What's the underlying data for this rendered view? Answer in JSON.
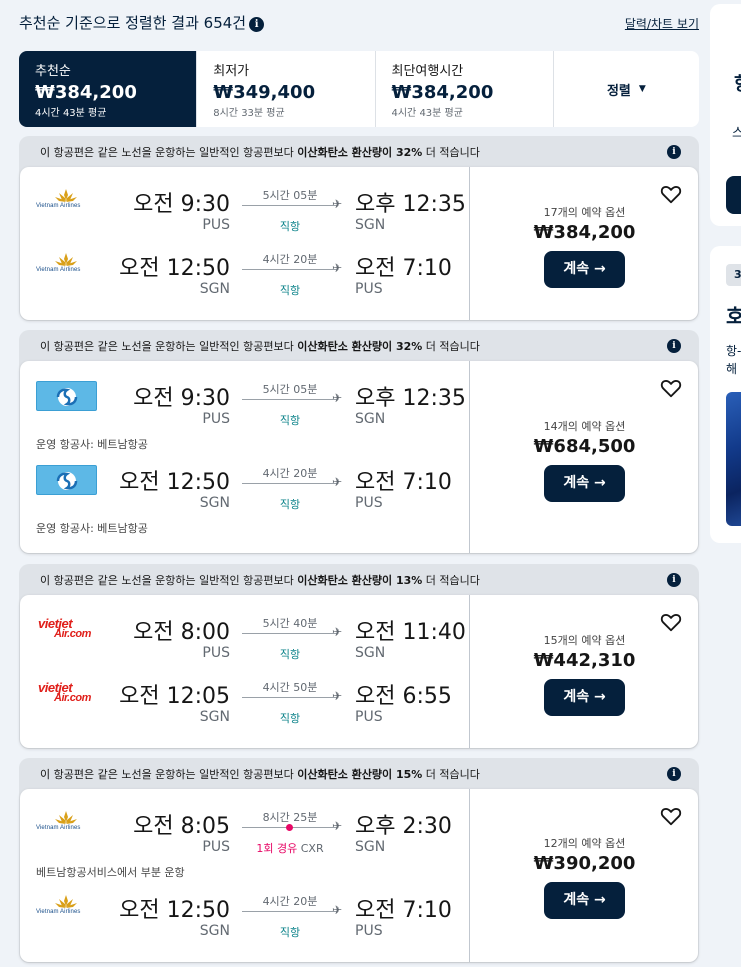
{
  "header": {
    "title": "추천순 기준으로 정렬한 결과 654건",
    "calendar_link": "달력/차트 보기"
  },
  "sort_tabs": [
    {
      "label": "추천순",
      "price": "₩384,200",
      "sub": "4시간 43분 평균"
    },
    {
      "label": "최저가",
      "price": "₩349,400",
      "sub": "8시간 33분 평균"
    },
    {
      "label": "최단여행시간",
      "price": "₩384,200",
      "sub": "4시간 43분 평균"
    }
  ],
  "sort_dropdown": "정렬",
  "cards": [
    {
      "eco_pre": "이 항공편은 같은 노선을 운항하는 일반적인 항공편보다 ",
      "eco_bold": "이산화탄소 환산량이 32%",
      "eco_post": " 더 적습니다",
      "legs": [
        {
          "dep_time": "오전 9:30",
          "dep_code": "PUS",
          "duration": "5시간 05분",
          "stops": "직항",
          "arr_time": "오후 12:35",
          "arr_code": "SGN"
        },
        {
          "dep_time": "오전 12:50",
          "dep_code": "SGN",
          "duration": "4시간 20분",
          "stops": "직항",
          "arr_time": "오전 7:10",
          "arr_code": "PUS"
        }
      ],
      "options": "17개의 예약 옵션",
      "price": "₩384,200",
      "select": "계속 →"
    },
    {
      "eco_pre": "이 항공편은 같은 노선을 운항하는 일반적인 항공편보다 ",
      "eco_bold": "이산화탄소 환산량이 32%",
      "eco_post": " 더 적습니다",
      "legs": [
        {
          "dep_time": "오전 9:30",
          "dep_code": "PUS",
          "duration": "5시간 05분",
          "stops": "직항",
          "arr_time": "오후 12:35",
          "arr_code": "SGN",
          "operated": "운영 항공사: 베트남항공"
        },
        {
          "dep_time": "오전 12:50",
          "dep_code": "SGN",
          "duration": "4시간 20분",
          "stops": "직항",
          "arr_time": "오전 7:10",
          "arr_code": "PUS",
          "operated": "운영 항공사: 베트남항공"
        }
      ],
      "options": "14개의 예약 옵션",
      "price": "₩684,500",
      "select": "계속 →"
    },
    {
      "eco_pre": "이 항공편은 같은 노선을 운항하는 일반적인 항공편보다 ",
      "eco_bold": "이산화탄소 환산량이 13%",
      "eco_post": " 더 적습니다",
      "legs": [
        {
          "dep_time": "오전 8:00",
          "dep_code": "PUS",
          "duration": "5시간 40분",
          "stops": "직항",
          "arr_time": "오전 11:40",
          "arr_code": "SGN"
        },
        {
          "dep_time": "오전 12:05",
          "dep_code": "SGN",
          "duration": "4시간 50분",
          "stops": "직항",
          "arr_time": "오전 6:55",
          "arr_code": "PUS"
        }
      ],
      "options": "15개의 예약 옵션",
      "price": "₩442,310",
      "select": "계속 →"
    },
    {
      "eco_pre": "이 항공편은 같은 노선을 운항하는 일반적인 항공편보다 ",
      "eco_bold": "이산화탄소 환산량이 15%",
      "eco_post": " 더 적습니다",
      "legs": [
        {
          "dep_time": "오전 8:05",
          "dep_code": "PUS",
          "duration": "8시간 25분",
          "stops": "1회 경유",
          "stops_via": "CXR",
          "arr_time": "오후 2:30",
          "arr_code": "SGN",
          "operated": "베트남항공서비스에서 부분 운항"
        },
        {
          "dep_time": "오전 12:50",
          "dep_code": "SGN",
          "duration": "4시간 20분",
          "stops": "직항",
          "arr_time": "오전 7:10",
          "arr_code": "PUS"
        }
      ],
      "options": "12개의 예약 옵션",
      "price": "₩390,200",
      "select": "계속 →"
    }
  ],
  "logos": {
    "vietnam_airlines": "Vietnam Airlines",
    "vietjet_1": "vietjet",
    "vietjet_2": "Air.com"
  },
  "side": {
    "s1_big": "항",
    "s1_small": "스",
    "s2_tag": "3",
    "s2_head": "호",
    "s2_t1": "항-",
    "s2_t2": "해"
  },
  "colors": {
    "brand_navy": "#05203c",
    "direct_teal": "#0c838a",
    "stop_pink": "#e70866",
    "vietjet_red": "#e0201b",
    "vietnam_gold": "#d9a019",
    "korean_air_blue": "#5db8e6"
  }
}
